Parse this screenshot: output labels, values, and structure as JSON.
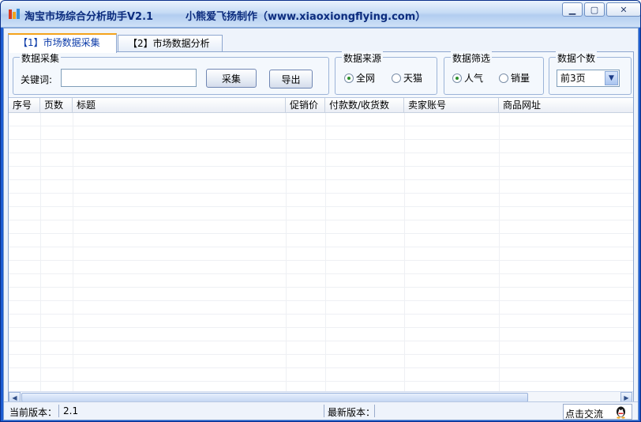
{
  "window": {
    "title": "淘宝市场综合分析助手V2.1",
    "subtitle": "小熊爱飞扬制作（www.xiaoxiongflying.com）"
  },
  "tabs": [
    {
      "label": "【1】市场数据采集",
      "active": true
    },
    {
      "label": "【2】市场数据分析",
      "active": false
    }
  ],
  "collect": {
    "legend": "数据采集",
    "keyword_label": "关键词:",
    "keyword_value": "",
    "collect_button": "采集",
    "export_button": "导出"
  },
  "source": {
    "legend": "数据来源",
    "options": [
      {
        "label": "全网",
        "checked": true
      },
      {
        "label": "天猫",
        "checked": false
      }
    ]
  },
  "filter": {
    "legend": "数据筛选",
    "options": [
      {
        "label": "人气",
        "checked": true
      },
      {
        "label": "销量",
        "checked": false
      }
    ]
  },
  "count": {
    "legend": "数据个数",
    "selected": "前3页"
  },
  "grid": {
    "columns": [
      "序号",
      "页数",
      "标题",
      "促销价",
      "付款数/收货数",
      "卖家账号",
      "商品网址"
    ]
  },
  "status": {
    "current_version_label": "当前版本：",
    "current_version_value": "2.1",
    "latest_version_label": "最新版本：",
    "latest_version_value": "",
    "chat_label": "点击交流"
  }
}
